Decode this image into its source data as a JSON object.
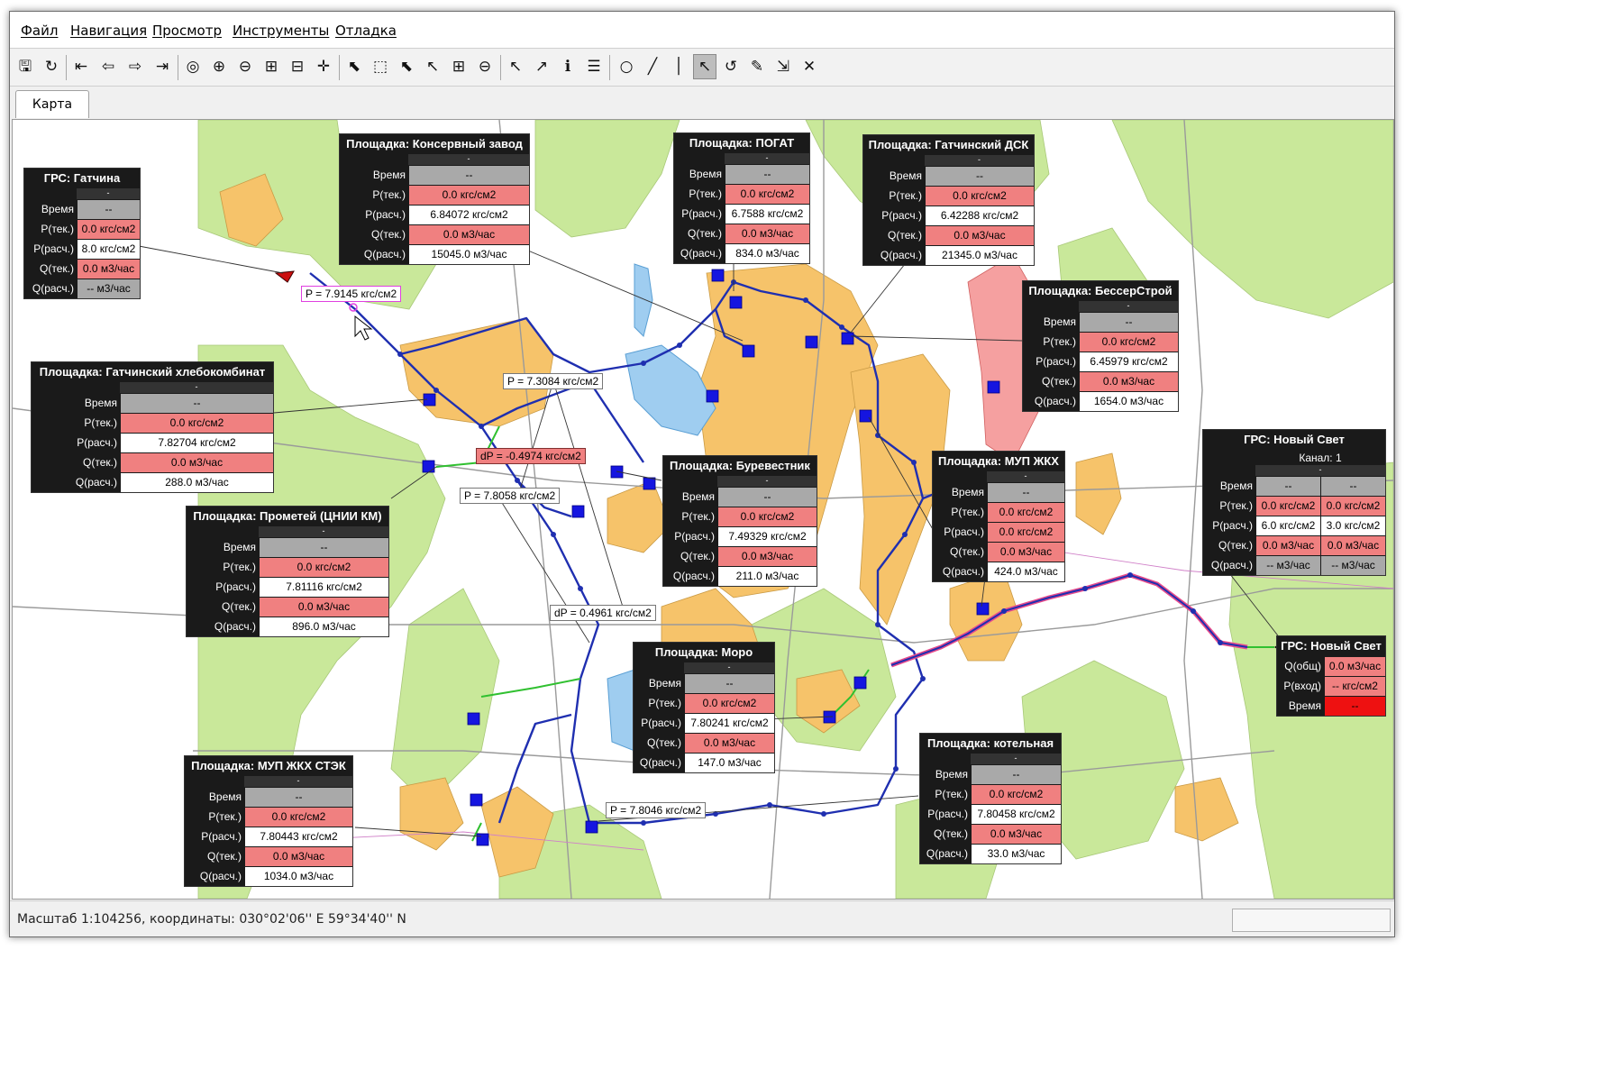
{
  "menu": [
    "Файл",
    "Навигация",
    "Просмотр",
    "Инструменты",
    "Отладка"
  ],
  "toolbar_icons": [
    "save-icon",
    "refresh-icon",
    "first-icon",
    "back-icon",
    "forward-icon",
    "last-icon",
    "globe-icon",
    "zoom-in-icon",
    "zoom-out-icon",
    "zoom-window-icon",
    "zoom-extent-icon",
    "pan-icon",
    "select-layer-icon",
    "select-rect-icon",
    "select-add-icon",
    "select-remove-icon",
    "select-grid-icon",
    "select-clear-icon",
    "identify-icon",
    "identify-point-icon",
    "info-icon",
    "info-list-icon",
    "circle-tool-icon",
    "measure-icon",
    "temperature-icon",
    "pointer-select-icon",
    "rotate-icon",
    "edit-icon",
    "export-icon",
    "close-icon"
  ],
  "tab": "Карта",
  "status": {
    "text": "Масштаб 1:104256, координаты: 030°02'06'' E 59°34'40'' N"
  },
  "labels": {
    "time": "Время",
    "p_cur": "P(тек.)",
    "p_calc": "P(расч.)",
    "q_cur": "Q(тек.)",
    "q_calc": "Q(расч.)",
    "q_total": "Q(общ)",
    "p_in": "P(вход)"
  },
  "pressure_tags": [
    {
      "text": "P = 7.9145 кгс/см2",
      "style": "pink"
    },
    {
      "text": "P = 7.3084 кгс/см2",
      "style": "plain"
    },
    {
      "text": "dP = -0.4974 кгс/см2",
      "style": "red"
    },
    {
      "text": "P = 7.8058 кгс/см2",
      "style": "plain"
    },
    {
      "text": "dP = 0.4961 кгс/см2",
      "style": "plain"
    },
    {
      "text": "P = 7.8046 кгс/см2",
      "style": "plain"
    }
  ],
  "panels": [
    {
      "title": "ГРС: Гатчина",
      "sub": "-",
      "time": "--",
      "p_cur": "0.0 кгс/см2",
      "p_calc": "8.0 кгс/см2",
      "q_cur": "0.0 м3/час",
      "q_calc": "-- м3/час"
    },
    {
      "title": "Площадка: Консервный завод",
      "sub": "-",
      "time": "--",
      "p_cur": "0.0 кгс/см2",
      "p_calc": "6.84072 кгс/см2",
      "q_cur": "0.0 м3/час",
      "q_calc": "15045.0 м3/час"
    },
    {
      "title": "Площадка: ПОГАТ",
      "sub": "-",
      "time": "--",
      "p_cur": "0.0 кгс/см2",
      "p_calc": "6.7588 кгс/см2",
      "q_cur": "0.0 м3/час",
      "q_calc": "834.0 м3/час"
    },
    {
      "title": "Площадка: Гатчинский ДСК",
      "sub": "-",
      "time": "--",
      "p_cur": "0.0 кгс/см2",
      "p_calc": "6.42288 кгс/см2",
      "q_cur": "0.0 м3/час",
      "q_calc": "21345.0 м3/час"
    },
    {
      "title": "Площадка: БессерСтрой",
      "sub": "-",
      "time": "--",
      "p_cur": "0.0 кгс/см2",
      "p_calc": "6.45979 кгс/см2",
      "q_cur": "0.0 м3/час",
      "q_calc": "1654.0 м3/час"
    },
    {
      "title": "Площадка: Гатчинский хлебокомбинат",
      "sub": "-",
      "time": "--",
      "p_cur": "0.0 кгс/см2",
      "p_calc": "7.82704 кгс/см2",
      "q_cur": "0.0 м3/час",
      "q_calc": "288.0 м3/час"
    },
    {
      "title": "Площадка: Прометей (ЦНИИ КМ)",
      "sub": "-",
      "time": "--",
      "p_cur": "0.0 кгс/см2",
      "p_calc": "7.81116 кгс/см2",
      "q_cur": "0.0 м3/час",
      "q_calc": "896.0 м3/час"
    },
    {
      "title": "Площадка: Буревестник",
      "sub": "-",
      "time": "--",
      "p_cur": "0.0 кгс/см2",
      "p_calc": "7.49329 кгс/см2",
      "q_cur": "0.0 м3/час",
      "q_calc": "211.0 м3/час"
    },
    {
      "title": "Площадка: МУП ЖКХ",
      "sub": "-",
      "time": "--",
      "p_cur": "0.0 кгс/см2",
      "p_calc": "0.0 кгс/см2",
      "q_cur": "0.0 м3/час",
      "q_calc": "424.0 м3/час"
    },
    {
      "title": "Площадка: Моро",
      "sub": "-",
      "time": "--",
      "p_cur": "0.0 кгс/см2",
      "p_calc": "7.80241 кгс/см2",
      "q_cur": "0.0 м3/час",
      "q_calc": "147.0 м3/час"
    },
    {
      "title": "Площадка: МУП ЖКХ СТЭК",
      "sub": "-",
      "time": "--",
      "p_cur": "0.0 кгс/см2",
      "p_calc": "7.80443 кгс/см2",
      "q_cur": "0.0 м3/час",
      "q_calc": "1034.0 м3/час"
    },
    {
      "title": "Площадка: котельная",
      "sub": "-",
      "time": "--",
      "p_cur": "0.0 кгс/см2",
      "p_calc": "7.80458 кгс/см2",
      "q_cur": "0.0 м3/час",
      "q_calc": "33.0 м3/час"
    }
  ],
  "grs_novy_svet": {
    "title": "ГРС: Новый Свет",
    "channel": "Канал: 1",
    "sub": "-",
    "time": [
      "--",
      "--"
    ],
    "p_cur": [
      "0.0 кгс/см2",
      "0.0 кгс/см2"
    ],
    "p_calc": [
      "6.0 кгс/см2",
      "3.0 кгс/см2"
    ],
    "q_cur": [
      "0.0 м3/час",
      "0.0 м3/час"
    ],
    "q_calc": [
      "-- м3/час",
      "-- м3/час"
    ]
  },
  "grs_novy_svet_small": {
    "title": "ГРС: Новый Свет",
    "q_total": "0.0 м3/час",
    "p_in": "-- кгс/см2",
    "time": "--"
  }
}
